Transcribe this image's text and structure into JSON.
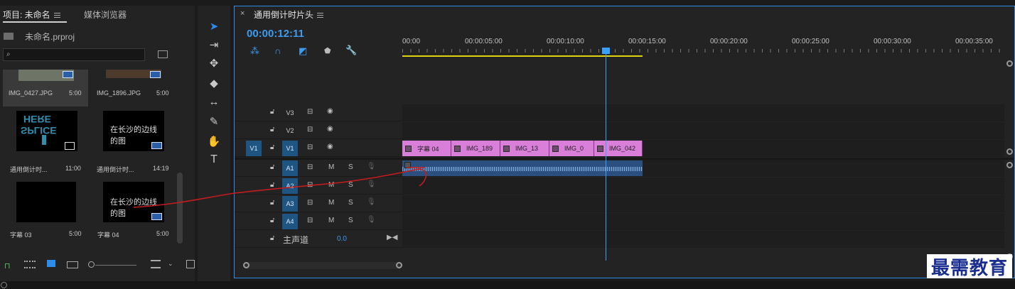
{
  "project": {
    "tab_active": "项目: 未命名",
    "tab_media": "媒体浏览器",
    "filename": "未命名.prproj",
    "search_placeholder": "",
    "items": [
      {
        "name": "IMG_0427.JPG",
        "duration": "5:00"
      },
      {
        "name": "IMG_1896.JPG",
        "duration": "5:00"
      },
      {
        "name": "通用倒计时...",
        "duration": "11:00"
      },
      {
        "name": "通用倒计时...",
        "duration": "14:19"
      },
      {
        "name": "字幕 03",
        "duration": "5:00"
      },
      {
        "name": "字幕 04",
        "duration": "5:00"
      }
    ],
    "thumb_texts": {
      "here": "HERE",
      "splice": "SPLICE",
      "caption": "在长沙的边线的图"
    }
  },
  "timeline": {
    "title": "通用倒计时片头",
    "timecode": "00:00:12:11",
    "ruler": [
      "00:00",
      "00:00:05:00",
      "00:00:10:00",
      "00:00:15:00",
      "00:00:20:00",
      "00:00:25:00",
      "00:00:30:00",
      "00:00:35:00"
    ],
    "video_tracks": [
      "V3",
      "V2",
      "V1"
    ],
    "source_patch": "V1",
    "audio_tracks": [
      "A1",
      "A2",
      "A3",
      "A4"
    ],
    "m_label": "M",
    "s_label": "S",
    "master_label": "主声道",
    "master_value": "0.0",
    "clips": [
      "字幕 04",
      "IMG_189",
      "IMG_13",
      "IMG_0",
      "IMG_042"
    ]
  },
  "watermark": "最需教育",
  "colors": {
    "accent": "#2d8ceb",
    "clip": "#d97fd9",
    "audio_clip": "#2b4f7e",
    "playhead": "#3aa0ff",
    "annotation": "#c41c1c"
  }
}
